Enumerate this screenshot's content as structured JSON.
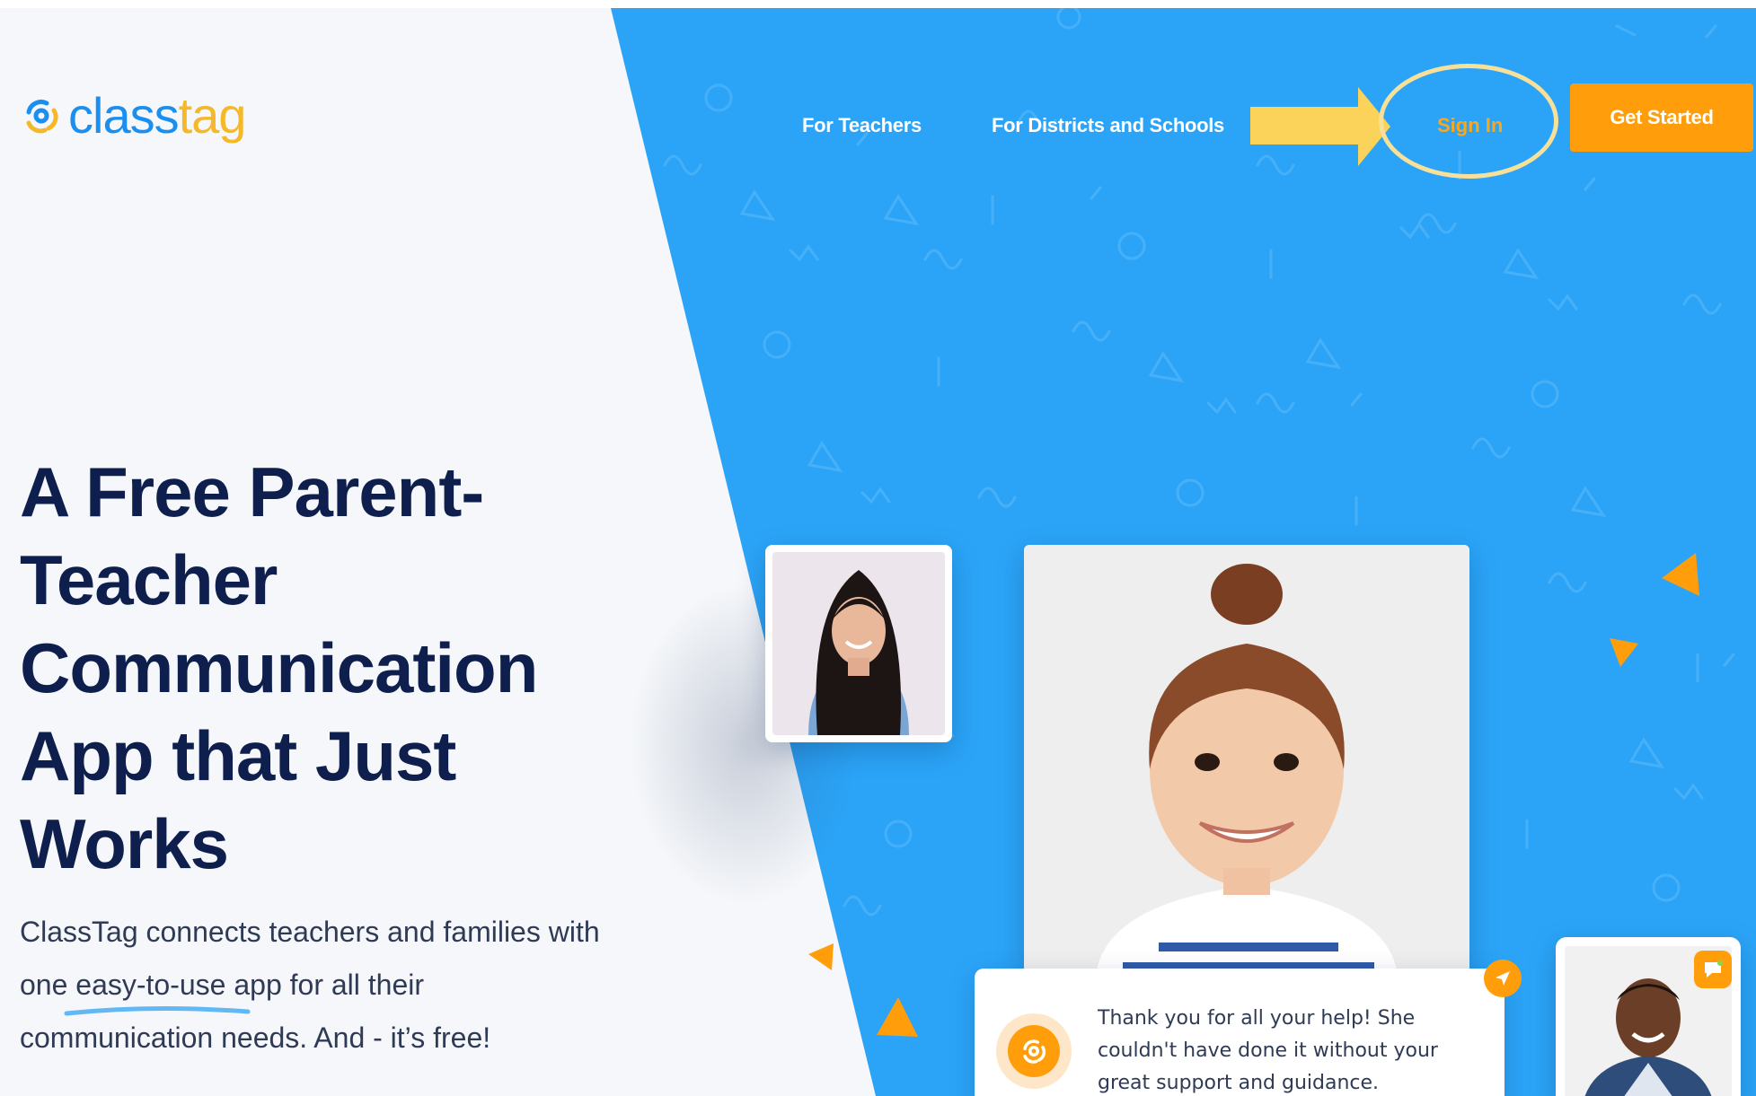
{
  "brand": {
    "name_part1": "class",
    "name_part2": "tag"
  },
  "nav": {
    "for_teachers": "For Teachers",
    "for_districts": "For Districts and Schools",
    "sign_in": "Sign In",
    "get_started": "Get Started"
  },
  "hero": {
    "title": "A Free Parent-Teacher Communication App that Just Works",
    "subtitle_line1": "ClassTag connects teachers and families with",
    "subtitle_line2": "one easy-to-use app for all their",
    "subtitle_line3": "communication needs. And - it’s free!"
  },
  "message": {
    "text": "Thank you for all your help! She couldn't have done it without your great support and guidance."
  },
  "icons": [
    "classtag-logo-icon",
    "send-icon",
    "chat-icon",
    "arrow-annotation",
    "circle-annotation"
  ],
  "colors": {
    "brand_blue": "#1b8ff0",
    "brand_yellow": "#f5b828",
    "panel_blue": "#2ba4f7",
    "accent_orange": "#ff9d0a",
    "heading_navy": "#0e1f4d"
  }
}
